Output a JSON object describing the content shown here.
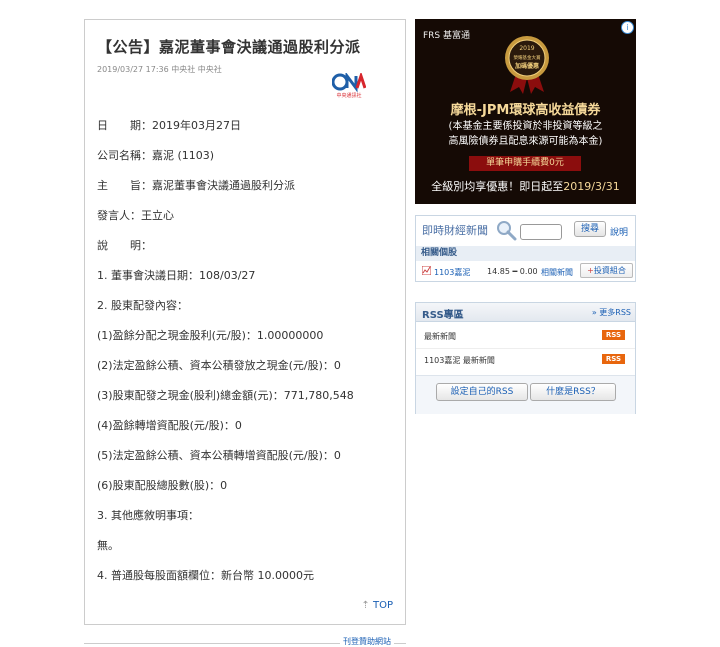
{
  "article": {
    "title": "【公告】嘉泥董事會決議通過股利分派",
    "meta": "2019/03/27 17:36  中央社 中央社",
    "logo_text": "中央通訊社",
    "lines": [
      "日　　期：2019年03月27日",
      "公司名稱：嘉泥 (1103)",
      "主　　旨：嘉泥董事會決議通過股利分派",
      "發言人：王立心",
      "說　　明：",
      "1. 董事會決議日期：108/03/27",
      "2. 股東配發內容：",
      "(1)盈餘分配之現金股利(元/股)：1.00000000",
      "(2)法定盈餘公積、資本公積發放之現金(元/股)：0",
      "(3)股東配發之現金(股利)總金額(元)：771,780,548",
      "(4)盈餘轉增資配股(元/股)：0",
      "(5)法定盈餘公積、資本公積轉增資配股(元/股)：0",
      "(6)股東配股總股數(股)：0",
      "3. 其他應敘明事項：",
      "無。",
      "4. 普通股每股面額欄位：新台幣 10.0000元"
    ],
    "top_link": "TOP"
  },
  "ad": {
    "brand": "FRS 基富通",
    "medal_line1": "2019",
    "medal_line2": "榮耀基金大賞",
    "medal_line3": "加碼優惠",
    "headline": "摩根-JPM環球高收益債券",
    "sub1": "(本基金主要係投資於非投資等級之",
    "sub2": "高風險債券且配息來源可能為本金)",
    "cta": "單筆申購手續費0元",
    "promo_prefix": "全級別均享優惠！即日起至",
    "promo_date": "2019/3/31",
    "info_icon": "i"
  },
  "finance": {
    "label": "即時財經新聞",
    "search_button": "搜尋",
    "explain": "說明",
    "related_title": "相關個股",
    "stock": {
      "code": "1103嘉泥",
      "price": "14.85 ━ 0.00",
      "news": "相關新聞",
      "portfolio": "投資組合"
    }
  },
  "rss": {
    "title": "RSS專區",
    "more": "» 更多RSS",
    "items": [
      "最新新聞",
      "1103嘉泥 最新新聞"
    ],
    "badge": "RSS",
    "btn_custom": "設定自己的RSS",
    "btn_what": "什麼是RSS？"
  },
  "footer": {
    "label": "刊登贊助網站"
  }
}
